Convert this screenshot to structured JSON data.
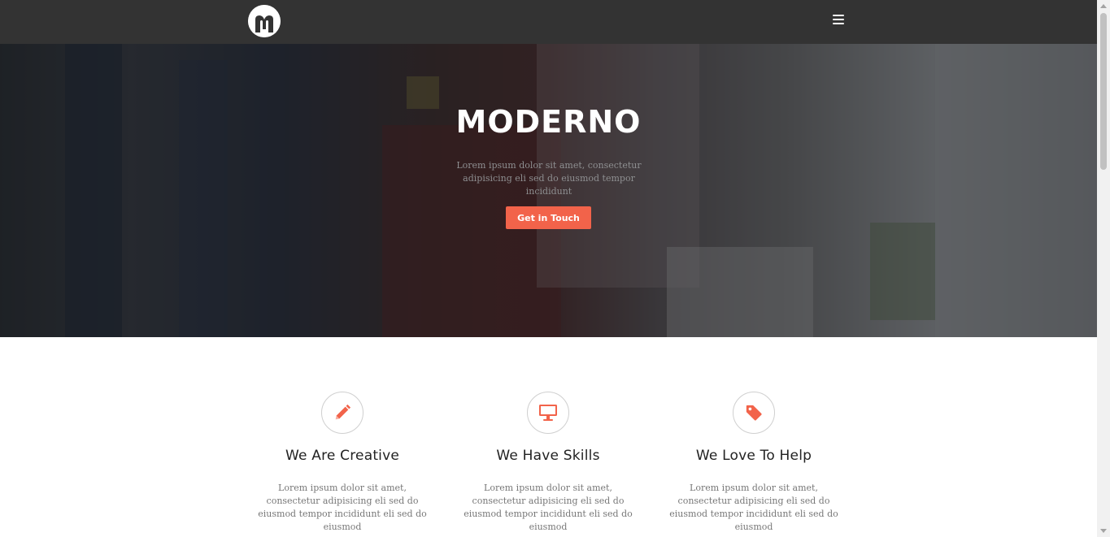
{
  "brand": {
    "logo_icon": "moderno-m-logo",
    "menu_icon": "hamburger-menu-icon"
  },
  "hero": {
    "title": "MODERNO",
    "subtitle": "Lorem ipsum dolor sit amet, consectetur adipisicing eli sed do eiusmod tempor incididunt",
    "cta_label": "Get in Touch"
  },
  "features": [
    {
      "icon": "pencil-icon",
      "title": "We Are Creative",
      "text": "Lorem ipsum dolor sit amet, consectetur adipisicing eli sed do eiusmod tempor incididunt eli sed do eiusmod"
    },
    {
      "icon": "monitor-icon",
      "title": "We Have Skills",
      "text": "Lorem ipsum dolor sit amet, consectetur adipisicing eli sed do eiusmod tempor incididunt eli sed do eiusmod"
    },
    {
      "icon": "tag-icon",
      "title": "We Love To Help",
      "text": "Lorem ipsum dolor sit amet, consectetur adipisicing eli sed do eiusmod tempor incididunt eli sed do eiusmod"
    }
  ],
  "colors": {
    "accent": "#f2634a",
    "navbar": "#333333"
  }
}
